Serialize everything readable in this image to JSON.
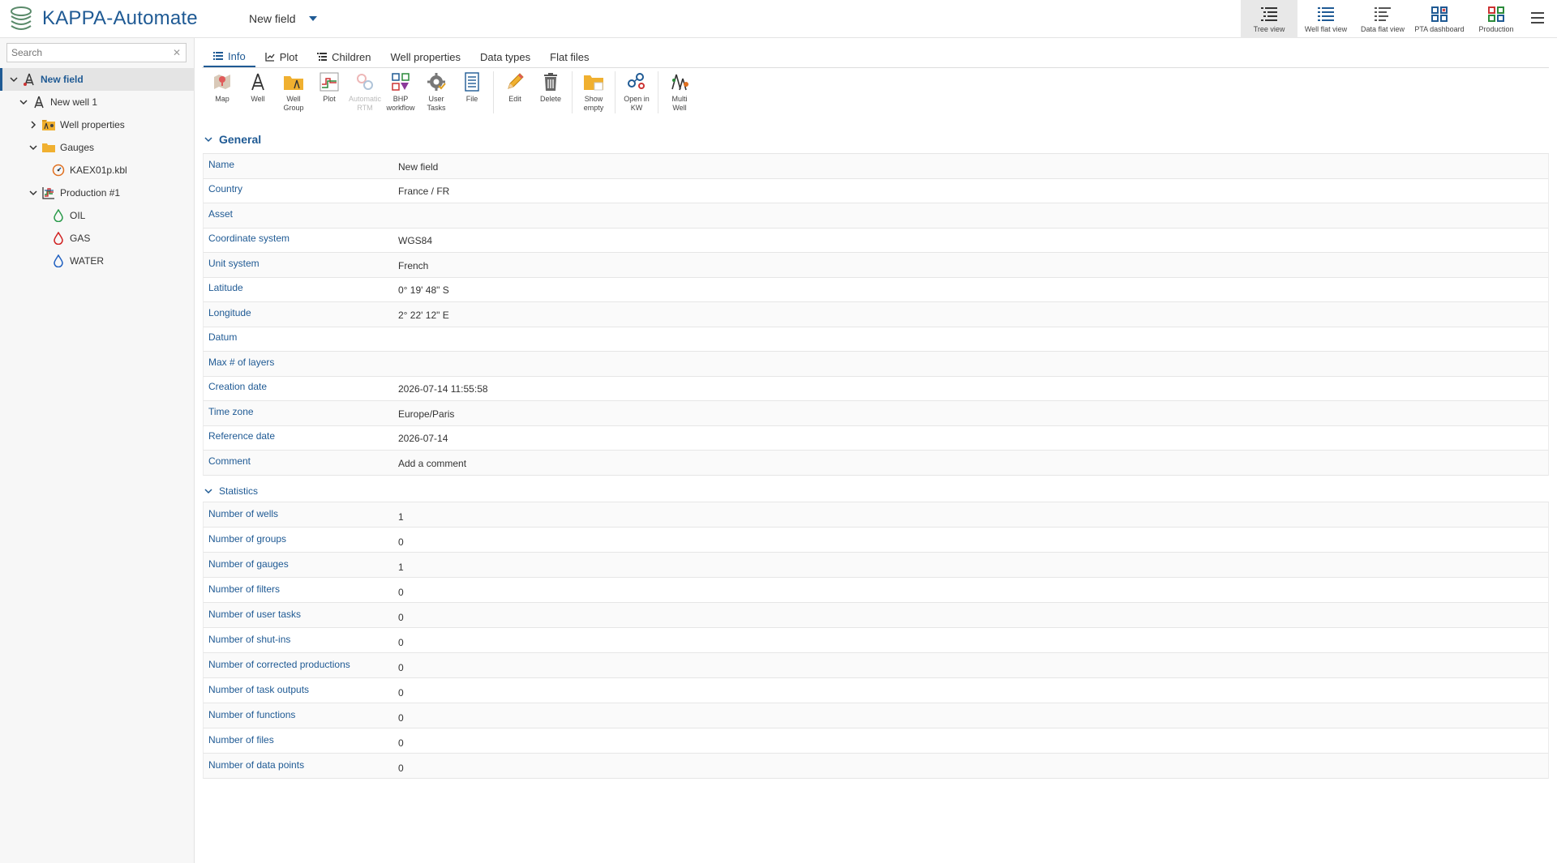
{
  "header": {
    "app_title": "KAPPA-Automate",
    "field_selector": "New field",
    "views": [
      {
        "label": "Tree view",
        "icon": "tree-view-icon"
      },
      {
        "label": "Well flat view",
        "icon": "well-flat-view-icon"
      },
      {
        "label": "Data flat view",
        "icon": "data-flat-view-icon"
      },
      {
        "label": "PTA dashboard",
        "icon": "pta-dashboard-icon"
      },
      {
        "label": "Production",
        "icon": "production-icon"
      }
    ],
    "colors": {
      "brand": "#1f5a94",
      "active_view_bg": "#e8e8e8"
    }
  },
  "sidebar": {
    "search_placeholder": "Search",
    "tree": [
      {
        "label": "New field",
        "icon": "field-icon",
        "expanded": true,
        "selected": true
      },
      {
        "label": "New well 1",
        "icon": "well-icon",
        "expanded": true
      },
      {
        "label": "Well properties",
        "icon": "well-properties-icon",
        "expanded": false
      },
      {
        "label": "Gauges",
        "icon": "folder-icon",
        "expanded": true
      },
      {
        "label": "KAEX01p.kbl",
        "icon": "gauge-icon"
      },
      {
        "label": "Production #1",
        "icon": "production-chart-icon",
        "expanded": true
      },
      {
        "label": "OIL",
        "icon": "oil-drop-icon"
      },
      {
        "label": "GAS",
        "icon": "gas-drop-icon"
      },
      {
        "label": "WATER",
        "icon": "water-drop-icon"
      }
    ]
  },
  "tabs": [
    {
      "label": "Info",
      "icon": "list-icon",
      "active": true
    },
    {
      "label": "Plot",
      "icon": "plot-icon"
    },
    {
      "label": "Children",
      "icon": "children-icon"
    },
    {
      "label": "Well properties"
    },
    {
      "label": "Data types"
    },
    {
      "label": "Flat files"
    }
  ],
  "toolbar": [
    {
      "label": "Map",
      "icon": "map-icon"
    },
    {
      "label": "Well",
      "icon": "well-icon"
    },
    {
      "label": "Well\nGroup",
      "icon": "well-group-icon"
    },
    {
      "label": "Plot",
      "icon": "plot-icon"
    },
    {
      "label": "Automatic\nRTM",
      "icon": "automatic-rtm-icon",
      "disabled": true
    },
    {
      "label": "BHP\nworkflow",
      "icon": "bhp-workflow-icon"
    },
    {
      "label": "User\nTasks",
      "icon": "user-tasks-icon"
    },
    {
      "label": "File",
      "icon": "file-icon"
    },
    {
      "label": "Edit",
      "icon": "edit-icon"
    },
    {
      "label": "Delete",
      "icon": "delete-icon"
    },
    {
      "label": "Show\nempty",
      "icon": "show-empty-icon"
    },
    {
      "label": "Open in\nKW",
      "icon": "open-in-kw-icon"
    },
    {
      "label": "Multi\nWell",
      "icon": "multi-well-icon"
    }
  ],
  "general": {
    "title": "General",
    "rows": [
      {
        "key": "Name",
        "value": "New field"
      },
      {
        "key": "Country",
        "value": "France / FR"
      },
      {
        "key": "Asset",
        "value": ""
      },
      {
        "key": "Coordinate system",
        "value": "WGS84"
      },
      {
        "key": "Unit system",
        "value": "French"
      },
      {
        "key": "Latitude",
        "value": "0° 19' 48\" S"
      },
      {
        "key": "Longitude",
        "value": "2° 22' 12\" E"
      },
      {
        "key": "Datum",
        "value": ""
      },
      {
        "key": "Max # of layers",
        "value": ""
      },
      {
        "key": "Creation date",
        "value": "2026-07-14 11:55:58"
      },
      {
        "key": "Time zone",
        "value": "Europe/Paris"
      },
      {
        "key": "Reference date",
        "value": "2026-07-14"
      },
      {
        "key": "Comment",
        "value": "Add a comment"
      }
    ]
  },
  "statistics": {
    "title": "Statistics",
    "rows": [
      {
        "key": "Number of wells",
        "value": "1"
      },
      {
        "key": "Number of groups",
        "value": "0"
      },
      {
        "key": "Number of gauges",
        "value": "1"
      },
      {
        "key": "Number of filters",
        "value": "0"
      },
      {
        "key": "Number of user tasks",
        "value": "0"
      },
      {
        "key": "Number of shut-ins",
        "value": "0"
      },
      {
        "key": "Number of corrected productions",
        "value": "0"
      },
      {
        "key": "Number of task outputs",
        "value": "0"
      },
      {
        "key": "Number of functions",
        "value": "0"
      },
      {
        "key": "Number of files",
        "value": "0"
      },
      {
        "key": "Number of data points",
        "value": "0"
      }
    ]
  }
}
